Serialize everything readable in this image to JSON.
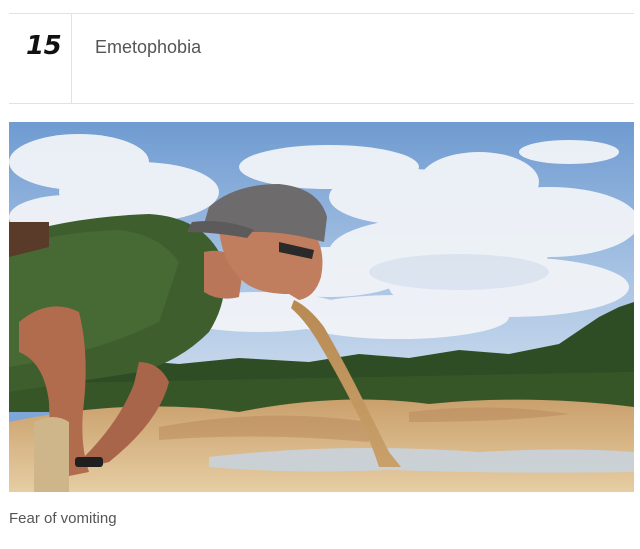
{
  "list_item": {
    "number": "15",
    "title": "Emetophobia",
    "caption": "Fear of vomiting"
  },
  "image": {
    "subject": "man-vomiting-sand-photo",
    "sky_color": "#7ea6d6",
    "sand_color": "#d9b88a"
  }
}
